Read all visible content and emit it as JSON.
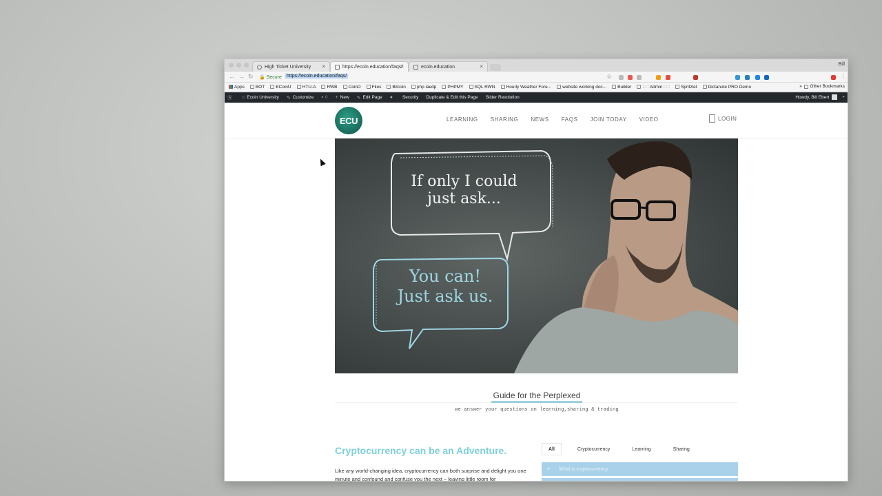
{
  "browser": {
    "tabs": [
      {
        "label": "High Ticket University"
      },
      {
        "label": "https://ecoin.education/faqs/"
      },
      {
        "label": "ecoin.education"
      }
    ],
    "user": "Bill",
    "secure_label": "Secure",
    "url": "https://ecoin.education/faqs/"
  },
  "bookmarks": {
    "items": [
      "Apps",
      "BOT",
      "ECoinU",
      "HTU-A",
      "RWB",
      "CoinD",
      "Files",
      "Bitcoin",
      "php laedp",
      "PHPMY",
      "SQL RWN",
      "Hourly Weather Fore...",
      "website working doc...",
      "Builder",
      ": : : Admin : : :",
      "Spritzlet",
      "Dictanote PRO Demo"
    ],
    "other": "Other Bookmarks"
  },
  "adminbar": {
    "items": [
      "Ecoin University",
      "Customize",
      "0",
      "New",
      "Edit Page",
      "Security",
      "Duplicate & Edit this Page",
      "Slider Revolution"
    ],
    "howdy": "Howdy, Bill Ebert"
  },
  "site": {
    "logo": "ECU",
    "nav": [
      "LEARNING",
      "SHARING",
      "NEWS",
      "FAQS",
      "JOIN TODAY",
      "VIDEO"
    ],
    "login": "LOGIN"
  },
  "hero": {
    "bubble1_line1": "If only I could",
    "bubble1_line2": "just ask...",
    "bubble2_line1": "You can!",
    "bubble2_line2": "Just ask us."
  },
  "guide": {
    "title": "Guide for the Perplexed",
    "subtitle": "we answer your questions on learning,sharing & trading"
  },
  "faq": {
    "heading": "Cryptocurrency can be an Adventure.",
    "intro": "Like any world-changing idea, cryptocurrency can both surprise and delight you one minute and confound and confuse you the next – leaving little room for",
    "tabs": [
      "All",
      "Cryptocurrency",
      "Learning",
      "Sharing"
    ],
    "first_question": "What is cryptocurrency",
    "plus": "+"
  },
  "colors": {
    "admin_bar": "#23282d",
    "logo_green": "#1a6b5c",
    "accent_teal": "#7fd0d8",
    "accordion_blue": "#a9d1ea"
  }
}
